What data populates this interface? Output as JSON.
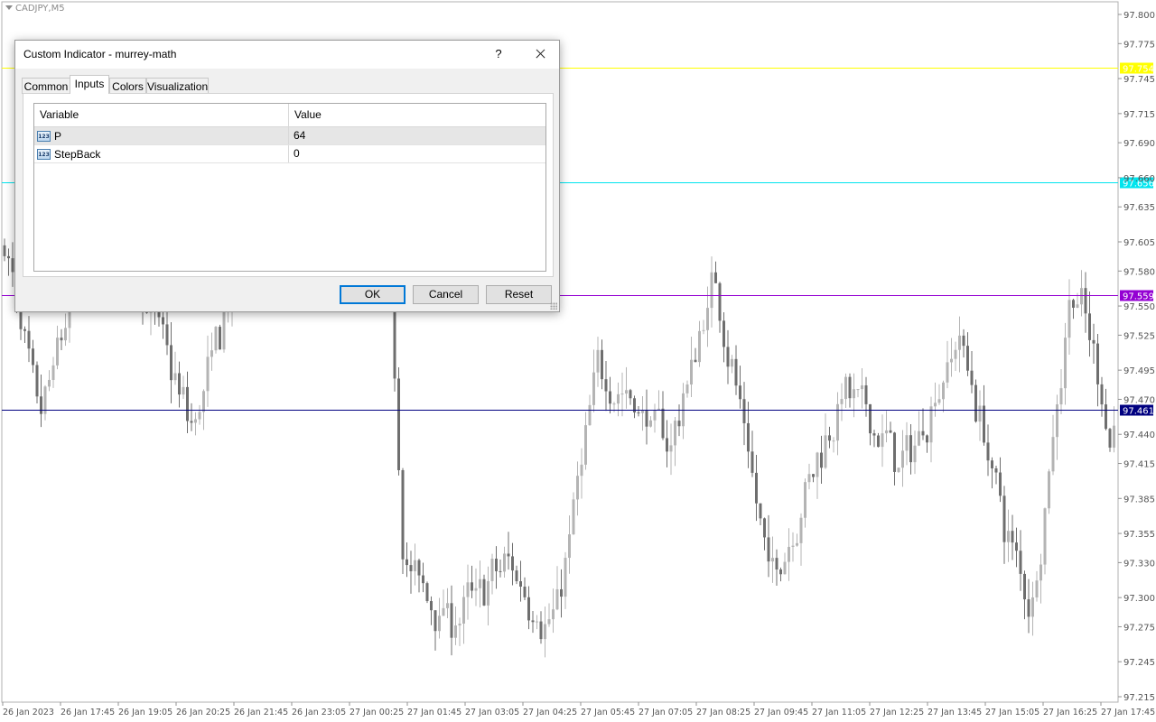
{
  "chart": {
    "symbol": "CADJPY,M5",
    "background": "#ffffff",
    "price_axis": [
      "97.800",
      "97.775",
      "97.745",
      "97.715",
      "97.690",
      "97.660",
      "97.635",
      "97.605",
      "97.580",
      "97.550",
      "97.525",
      "97.495",
      "97.470",
      "97.440",
      "97.415",
      "97.385",
      "97.355",
      "97.330",
      "97.300",
      "97.275",
      "97.245",
      "97.215"
    ],
    "time_axis": [
      "26 Jan 2023",
      "26 Jan 17:45",
      "26 Jan 19:05",
      "26 Jan 20:25",
      "26 Jan 21:45",
      "26 Jan 23:05",
      "27 Jan 00:25",
      "27 Jan 01:45",
      "27 Jan 03:05",
      "27 Jan 04:25",
      "27 Jan 05:45",
      "27 Jan 07:05",
      "27 Jan 08:25",
      "27 Jan 09:45",
      "27 Jan 11:05",
      "27 Jan 12:25",
      "27 Jan 13:45",
      "27 Jan 15:05",
      "27 Jan 16:25",
      "27 Jan 17:45"
    ],
    "levels": [
      {
        "value": "97.754",
        "color": "#ffff00",
        "label_text_color": "#ffffff"
      },
      {
        "value": "97.656",
        "color": "#00e5ee",
        "label_text_color": "#ffffff"
      },
      {
        "value": "97.559",
        "color": "#9400d3",
        "label_text_color": "#ffffff"
      },
      {
        "value": "97.461",
        "color": "#000080",
        "label_text_color": "#ffffff"
      }
    ],
    "candle_colors": {
      "bull": "#b4b4b4",
      "bear": "#6e6e6e"
    }
  },
  "dialog": {
    "title": "Custom Indicator - murrey-math",
    "help_label": "?",
    "tabs": [
      {
        "label": "Common",
        "active": false
      },
      {
        "label": "Inputs",
        "active": true
      },
      {
        "label": "Colors",
        "active": false
      },
      {
        "label": "Visualization",
        "active": false
      }
    ],
    "grid": {
      "headers": {
        "variable": "Variable",
        "value": "Value"
      },
      "rows": [
        {
          "icon": "123",
          "variable": "P",
          "value": "64",
          "selected": true
        },
        {
          "icon": "123",
          "variable": "StepBack",
          "value": "0",
          "selected": false
        }
      ]
    },
    "buttons": {
      "ok": "OK",
      "cancel": "Cancel",
      "reset": "Reset"
    }
  }
}
